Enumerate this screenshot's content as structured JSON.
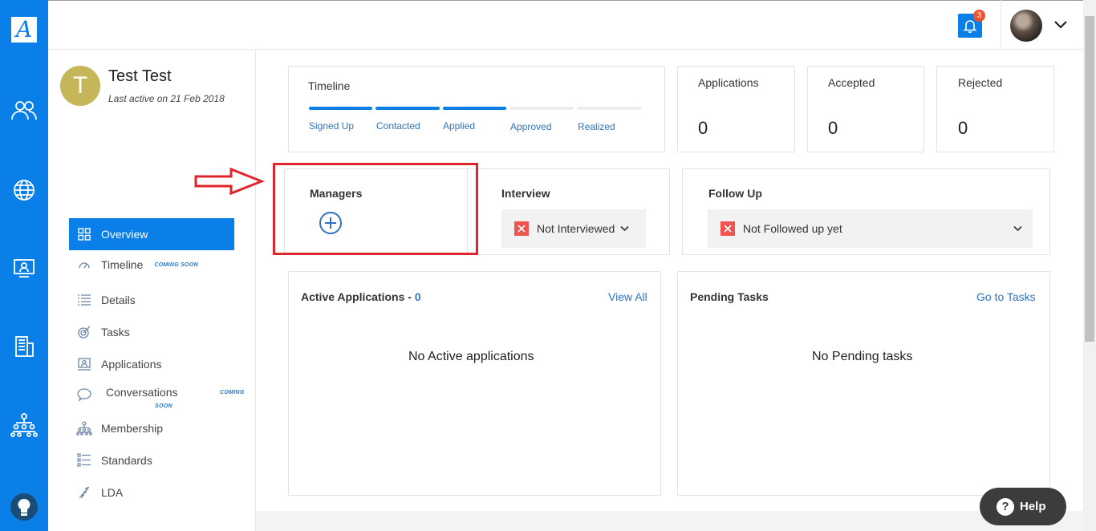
{
  "header": {
    "notification_count": "3"
  },
  "colors": {
    "brand_blue": "#0a7fe8",
    "link_blue": "#2f74c0",
    "error_red": "#f0544f",
    "annotation_red": "#e0262d",
    "avatar_olive": "#c5b659"
  },
  "rail": {
    "logo_letter": "A",
    "icons": [
      "people-icon",
      "globe-icon",
      "monitor-user-icon",
      "building-icon",
      "org-chart-icon",
      "lightbulb-icon"
    ]
  },
  "profile": {
    "initial": "T",
    "name": "Test Test",
    "last_active": "Last active on 21 Feb 2018"
  },
  "nav": {
    "items": [
      {
        "label": "Overview",
        "icon": "grid-icon"
      },
      {
        "label": "Timeline",
        "icon": "gauge-icon",
        "badge": "COMING SOON"
      },
      {
        "label": "Details",
        "icon": "list-icon"
      },
      {
        "label": "Tasks",
        "icon": "target-icon"
      },
      {
        "label": "Applications",
        "icon": "profile-card-icon"
      },
      {
        "label": "Conversations",
        "icon": "chat-bubble-icon",
        "badge_line1": "COMING",
        "badge_line2": "SOON"
      },
      {
        "label": "Membership",
        "icon": "org-chart-icon"
      },
      {
        "label": "Standards",
        "icon": "checklist-icon"
      },
      {
        "label": "LDA",
        "icon": "dna-icon"
      }
    ]
  },
  "timeline": {
    "title": "Timeline",
    "stages": [
      "Signed Up",
      "Contacted",
      "Applied",
      "Approved",
      "Realized"
    ],
    "completed_stages": 3
  },
  "stats": {
    "applications": {
      "label": "Applications",
      "value": "0"
    },
    "accepted": {
      "label": "Accepted",
      "value": "0"
    },
    "rejected": {
      "label": "Rejected",
      "value": "0"
    }
  },
  "managers": {
    "title": "Managers"
  },
  "interview": {
    "title": "Interview",
    "status": "Not Interviewed"
  },
  "followup": {
    "title": "Follow Up",
    "status": "Not Followed up yet"
  },
  "active_applications": {
    "title": "Active Applications - ",
    "count": "0",
    "link": "View All",
    "empty": "No Active applications"
  },
  "pending_tasks": {
    "title": "Pending Tasks",
    "link": "Go to Tasks",
    "empty": "No Pending tasks"
  },
  "help": {
    "label": "Help",
    "glyph": "?"
  }
}
